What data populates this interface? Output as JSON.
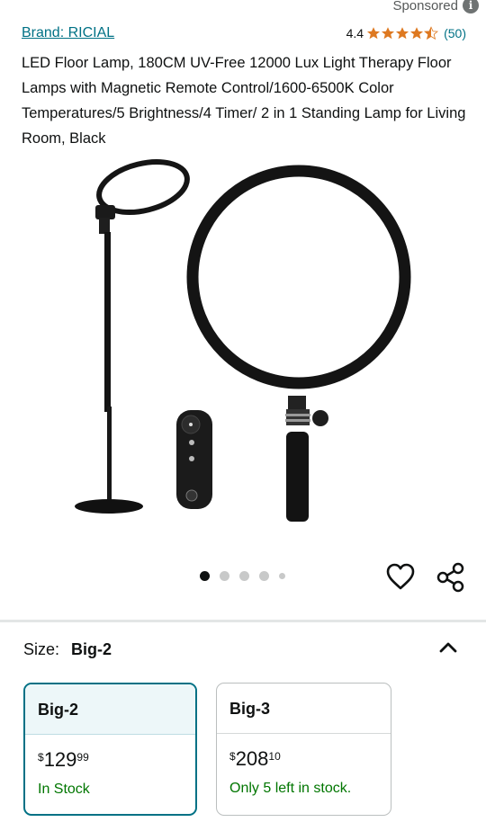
{
  "sponsored": {
    "label": "Sponsored",
    "icon": "info-icon"
  },
  "product": {
    "brand": "Brand: RICIAL",
    "rating": "4.4",
    "stars": 4.5,
    "review_count": "(50)",
    "title": "LED Floor Lamp, 180CM UV-Free 12000 Lux Light Therapy Floor Lamps with Magnetic Remote Control/1600-6500K Color Temperatures/5 Brightness/4 Timer/ 2 in 1 Standing Lamp for Living Room, Black"
  },
  "carousel": {
    "count": 5,
    "active": 1
  },
  "actions": {
    "heart_icon": "heart-icon",
    "share_icon": "share-icon"
  },
  "size": {
    "label": "Size:",
    "value": "Big-2",
    "collapse_icon": "chevron-up-icon",
    "options": [
      {
        "name": "Big-2",
        "price_symbol": "$",
        "price_whole": "129",
        "price_fraction": "99",
        "stock": "In Stock",
        "selected": true
      },
      {
        "name": "Big-3",
        "price_symbol": "$",
        "price_whole": "208",
        "price_fraction": "10",
        "stock": "Only 5 left in stock.",
        "selected": false
      }
    ]
  },
  "colors": {
    "link": "#007185",
    "star": "#de7921",
    "in_stock": "#007600",
    "selected_border": "#007185"
  }
}
